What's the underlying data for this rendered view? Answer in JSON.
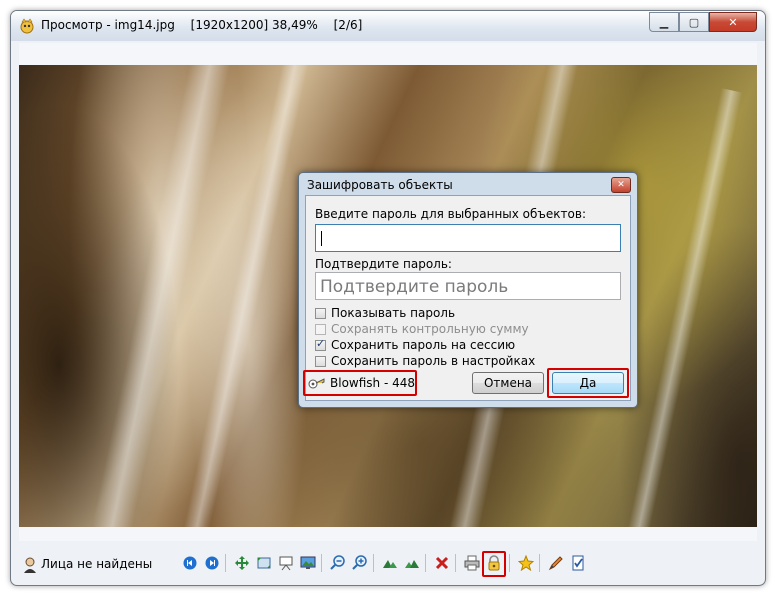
{
  "window": {
    "title_app": "Просмотр - img14.jpg",
    "title_res": "[1920x1200] 38,49%",
    "title_index": "[2/6]",
    "controls": [
      "minimize",
      "maximize",
      "close"
    ]
  },
  "dialog": {
    "title": "Зашифровать объекты",
    "password_label": "Введите пароль для выбранных объектов:",
    "password_value": "",
    "confirm_label": "Подтвердите пароль:",
    "confirm_placeholder": "Подтвердите пароль",
    "checkboxes": [
      {
        "label": "Показывать пароль",
        "checked": false,
        "enabled": true
      },
      {
        "label": "Сохранять контрольную сумму",
        "checked": false,
        "enabled": false
      },
      {
        "label": "Сохранить пароль на сессию",
        "checked": true,
        "enabled": true
      },
      {
        "label": "Сохранить пароль в настройках",
        "checked": false,
        "enabled": true
      }
    ],
    "algorithm": "Blowfish - 448",
    "cancel_label": "Отмена",
    "ok_label": "Да"
  },
  "statusbar": {
    "text": "Лица не найдены",
    "toolbar_icons": [
      "prev-icon",
      "next-icon",
      "fit-icon",
      "fullsize-icon",
      "slideshow-icon",
      "wallpaper-icon",
      "zoom-out-icon",
      "zoom-in-icon",
      "rotate-left-icon",
      "rotate-right-icon",
      "delete-icon",
      "print-icon",
      "encrypt-icon",
      "favorite-icon",
      "edit-icon",
      "properties-icon"
    ]
  },
  "colors": {
    "highlight": "#d40000",
    "accent": "#3c7fb1"
  }
}
